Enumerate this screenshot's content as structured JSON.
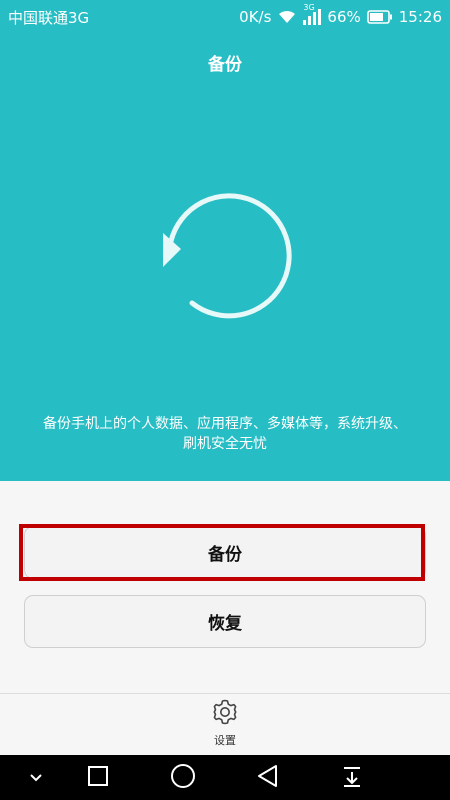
{
  "status_bar": {
    "carrier": "中国联通3G",
    "speed": "0K/s",
    "network_type": "3G",
    "battery": "66%",
    "time": "15:26"
  },
  "header": {
    "title": "备份"
  },
  "main": {
    "description_line1": "备份手机上的个人数据、应用程序、多媒体等，系统升级、",
    "description_line2": "刷机安全无忧"
  },
  "buttons": {
    "backup_label": "备份",
    "restore_label": "恢复"
  },
  "bottom_bar": {
    "settings_label": "设置"
  },
  "colors": {
    "accent": "#26bec4",
    "highlight": "#c00000"
  },
  "icons": {
    "sync": "sync-icon",
    "settings": "gear-icon",
    "nav_collapse": "chevron-down-icon",
    "nav_recents": "square-icon",
    "nav_home": "circle-icon",
    "nav_back": "triangle-back-icon",
    "nav_notifications": "pull-down-icon"
  }
}
